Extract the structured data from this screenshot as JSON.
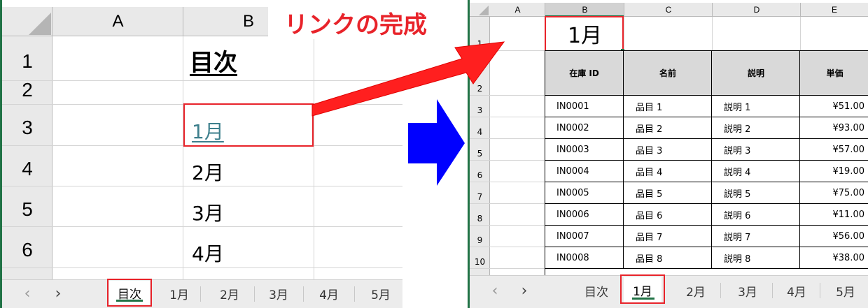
{
  "left_sheet": {
    "columns": [
      "A",
      "B"
    ],
    "rows": [
      {
        "num": "1",
        "b": "目次"
      },
      {
        "num": "2",
        "b": ""
      },
      {
        "num": "3",
        "b": "1月"
      },
      {
        "num": "4",
        "b": "2月"
      },
      {
        "num": "5",
        "b": "3月"
      },
      {
        "num": "6",
        "b": "4月"
      }
    ],
    "tabs": [
      "目次",
      "1月",
      "2月",
      "3月",
      "4月",
      "5月"
    ],
    "nav": {
      "prev": "‹",
      "next": "›"
    }
  },
  "callout": {
    "text": "リンクの完成"
  },
  "right_sheet": {
    "columns": [
      "A",
      "B",
      "C",
      "D",
      "E"
    ],
    "title_cell": "1月",
    "table": {
      "headers": [
        "在庫 ID",
        "名前",
        "説明",
        "単価"
      ],
      "rows": [
        {
          "num": "3",
          "id": "IN0001",
          "name": "品目 1",
          "desc": "説明 1",
          "price": "¥51.00"
        },
        {
          "num": "4",
          "id": "IN0002",
          "name": "品目 2",
          "desc": "説明 2",
          "price": "¥93.00"
        },
        {
          "num": "5",
          "id": "IN0003",
          "name": "品目 3",
          "desc": "説明 3",
          "price": "¥57.00"
        },
        {
          "num": "6",
          "id": "IN0004",
          "name": "品目 4",
          "desc": "説明 4",
          "price": "¥19.00"
        },
        {
          "num": "7",
          "id": "IN0005",
          "name": "品目 5",
          "desc": "説明 5",
          "price": "¥75.00"
        },
        {
          "num": "8",
          "id": "IN0006",
          "name": "品目 6",
          "desc": "説明 6",
          "price": "¥11.00"
        },
        {
          "num": "9",
          "id": "IN0007",
          "name": "品目 7",
          "desc": "説明 7",
          "price": "¥56.00"
        },
        {
          "num": "10",
          "id": "IN0008",
          "name": "品目 8",
          "desc": "説明 8",
          "price": "¥38.00"
        }
      ]
    },
    "row_nums_top": [
      "1",
      "2"
    ],
    "tabs": [
      "目次",
      "1月",
      "2月",
      "3月",
      "4月",
      "5月"
    ],
    "nav": {
      "prev": "‹",
      "next": "›"
    }
  },
  "colors": {
    "highlight_red": "#e8232a",
    "arrow_blue": "#0000ff",
    "link_teal": "#3d7f8c",
    "excel_green": "#217346"
  }
}
